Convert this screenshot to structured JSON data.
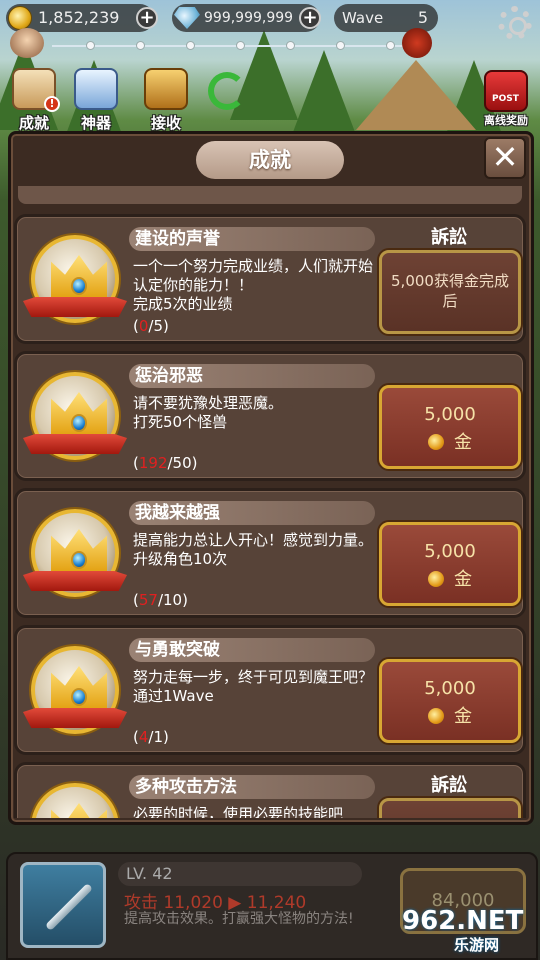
{
  "hud": {
    "coins": "1,852,239",
    "gems": "999,999,999",
    "wave_label": "Wave",
    "wave_value": "5"
  },
  "top_menu": [
    {
      "label": "成就",
      "icon": "scroll-icon"
    },
    {
      "label": "神器",
      "icon": "artifact-icon"
    },
    {
      "label": "接收",
      "icon": "treasure-chest-icon"
    },
    {
      "label": "",
      "icon": "refresh-icon"
    },
    {
      "label": "离线奖励",
      "icon": "mailbox-icon"
    }
  ],
  "mailbox_tag": "POST",
  "modal": {
    "title": "成就",
    "close_label": "✕"
  },
  "achievements": [
    {
      "title": "建设的声誉",
      "desc": "一个一个努力完成业绩，人们就开始认定你的能力！！",
      "condition": "完成5次的业绩",
      "progress_current": "0",
      "progress_total": "/5",
      "state": "訴訟",
      "claim_text": "5,000获得金完成后"
    },
    {
      "title": "惩治邪恶",
      "desc": "请不要犹豫处理恶魔。",
      "condition": "打死50个怪兽",
      "progress_current": "192",
      "progress_total": "/50",
      "reward_amount": "5,000",
      "reward_unit": "金"
    },
    {
      "title": "我越来越强",
      "desc": "提高能力总让人开心！感觉到力量。",
      "condition": "升级角色10次",
      "progress_current": "57",
      "progress_total": "/10",
      "reward_amount": "5,000",
      "reward_unit": "金"
    },
    {
      "title": "与勇敢突破",
      "desc": "努力走每一步，终于可见到魔王吧？",
      "condition": "通过1Wave",
      "progress_current": "4",
      "progress_total": "/1",
      "reward_amount": "5,000",
      "reward_unit": "金"
    },
    {
      "title": "多种攻击方法",
      "desc": "必要的时候，使用必要的技能吧",
      "state": "訴訟"
    }
  ],
  "bottom": {
    "level": "LV. 42",
    "attack_line": "攻击 11,020 ▶ 11,240",
    "desc": "提高攻击效果。打赢强大怪物的方法!",
    "upgrade_cost": "84,000"
  },
  "watermark": {
    "logo": "962.NET",
    "sub": "乐游网"
  }
}
